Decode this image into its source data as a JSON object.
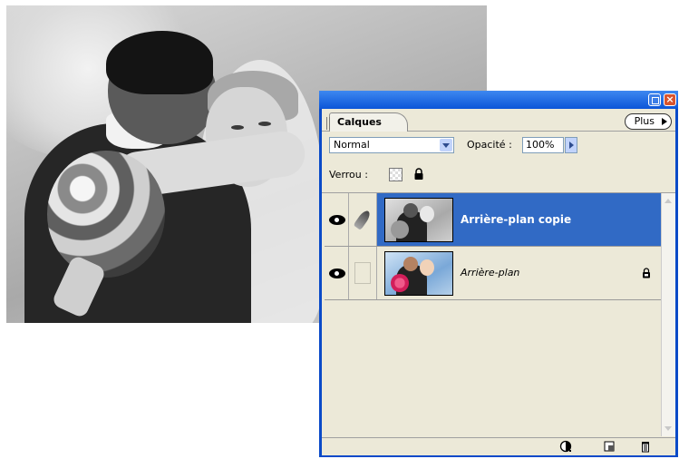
{
  "panel": {
    "tab_label": "Calques",
    "plus_label": "Plus",
    "blend_mode": "Normal",
    "opacity_label": "Opacité :",
    "opacity_value": "100%",
    "lock_label": "Verrou :"
  },
  "layers": [
    {
      "name": "Arrière-plan copie",
      "selected": true,
      "visible": true,
      "locked": false
    },
    {
      "name": "Arrière-plan",
      "selected": false,
      "visible": true,
      "locked": true
    }
  ],
  "colors": {
    "title_bar": "#0b55d8",
    "selection": "#316ac5",
    "panel_bg": "#ece9d8"
  },
  "icons": [
    "eye-icon",
    "brush-icon",
    "lock-icon",
    "transparency-lock-icon",
    "adjustment-layer-icon",
    "new-layer-icon",
    "trash-icon",
    "minimize-icon",
    "close-icon"
  ]
}
